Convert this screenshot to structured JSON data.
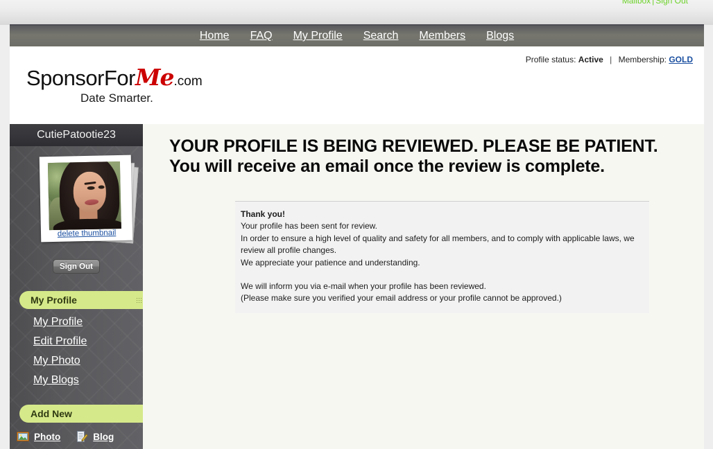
{
  "topbar": {
    "mailbox_label": "Mailbox",
    "separator": "|",
    "signout_label": "Sign Out",
    "link_color": "#6cd229"
  },
  "nav": {
    "items": [
      {
        "label": "Home"
      },
      {
        "label": "FAQ"
      },
      {
        "label": "My Profile"
      },
      {
        "label": "Search"
      },
      {
        "label": "Members"
      },
      {
        "label": "Blogs"
      }
    ]
  },
  "header": {
    "logo": {
      "part1": "SponsorFor",
      "part2": "Me",
      "part3": ".com",
      "tagline": "Date Smarter."
    },
    "status": {
      "profile_status_label": "Profile status:",
      "profile_status_value": "Active",
      "divider": "|",
      "membership_label": "Membership:",
      "membership_value": "GOLD",
      "membership_color": "#1a4fa0"
    }
  },
  "sidebar": {
    "username": "CutiePatootie23",
    "photo": {
      "delete_label": "delete thumbnail"
    },
    "signout_button": "Sign Out",
    "sections": [
      {
        "title": "My Profile",
        "links": [
          {
            "label": "My Profile"
          },
          {
            "label": "Edit Profile"
          },
          {
            "label": "My Photo"
          },
          {
            "label": "My Blogs"
          }
        ]
      },
      {
        "title": "Add New",
        "items": [
          {
            "label": "Photo",
            "icon": "image-icon"
          },
          {
            "label": "Blog",
            "icon": "notepad-pencil-icon"
          }
        ]
      }
    ],
    "pill_color": "#d6e98a"
  },
  "main": {
    "headline_line1": "YOUR PROFILE IS BEING REVIEWED. PLEASE BE PATIENT.",
    "headline_line2": "You will receive an email once the review is complete.",
    "message": {
      "title": "Thank you!",
      "line1": "Your profile has been sent for review.",
      "line2": "In order to ensure a high level of quality and safety for all members, and to comply with applicable laws, we review all profile changes.",
      "line3": "We appreciate your patience and understanding.",
      "line4": "We will inform you via e-mail when your profile has been reviewed.",
      "line5": "(Please make sure you verified your email address or your profile cannot be approved.)"
    }
  }
}
